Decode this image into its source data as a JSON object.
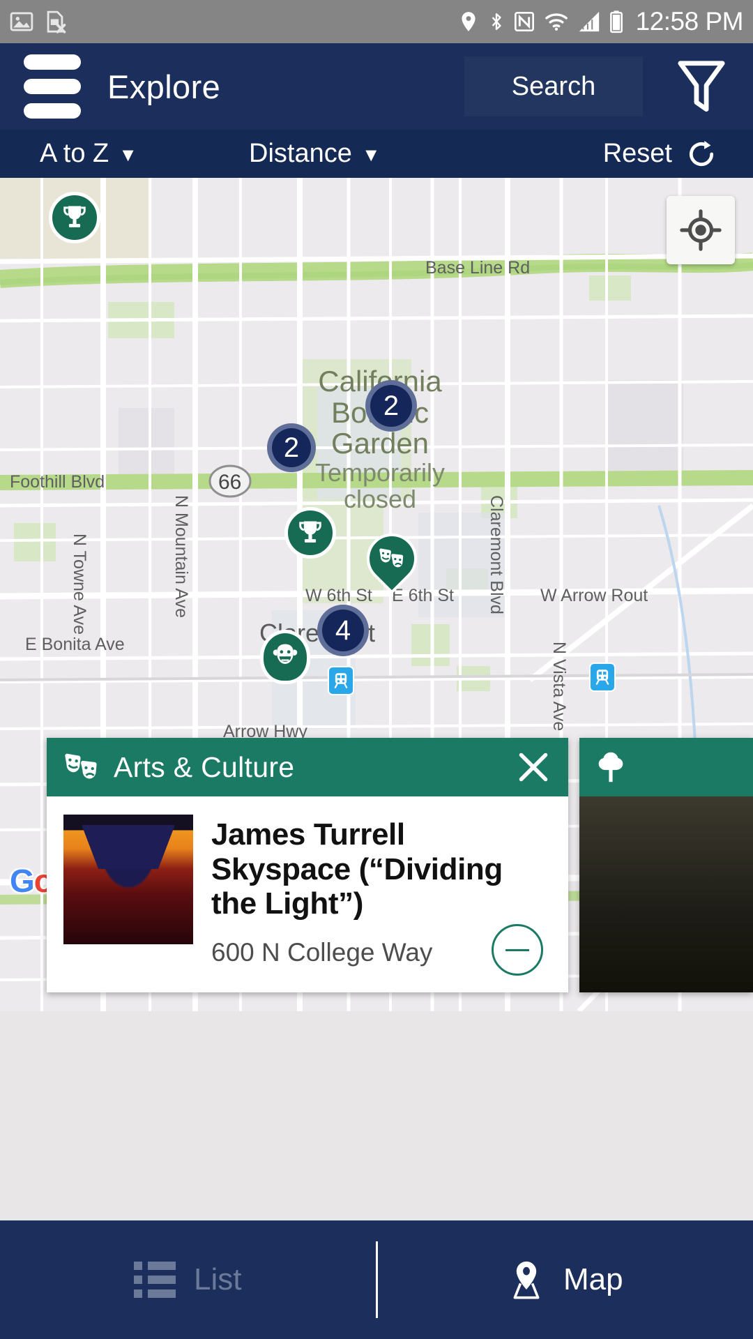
{
  "status_bar": {
    "time": "12:58 PM",
    "left_icons": [
      "photo-icon",
      "sim-card-error-icon"
    ],
    "right_icons": [
      "location-icon",
      "bluetooth-icon",
      "nfc-icon",
      "wifi-icon",
      "signal-icon",
      "battery-icon"
    ],
    "background": "#858585"
  },
  "header": {
    "menu_icon": "hamburger-icon",
    "title": "Explore",
    "search_label": "Search",
    "filter_icon": "funnel-icon",
    "background": "#1c2f5c"
  },
  "sort_bar": {
    "alpha_label": "A to Z",
    "alpha_caret": "▼",
    "distance_label": "Distance",
    "distance_caret": "▼",
    "reset_label": "Reset",
    "reset_icon": "refresh-icon",
    "background": "#142a55"
  },
  "map": {
    "provider_logo": "Google",
    "locate_icon": "my-location-icon",
    "navigate_icon": "navigation-arrow-icon",
    "place_label": {
      "name_line1": "California",
      "name_line2": "Botanic",
      "name_line3": "Garden",
      "status_line1": "Temporarily",
      "status_line2": "closed"
    },
    "street_labels": [
      "Base Line Rd",
      "Foothill Blvd",
      "N Towne Ave",
      "N Mountain Ave",
      "Claremont Blvd",
      "W 6th St",
      "E 6th St",
      "W Arrow Rout",
      "E Bonita Ave",
      "Arrow Hwy",
      "Claremont",
      "N Vista Ave"
    ],
    "route_shield": "66",
    "clusters": [
      {
        "count": "2"
      },
      {
        "count": "2"
      },
      {
        "count": "4"
      }
    ],
    "markers": [
      {
        "icon": "trophy-icon",
        "category": "sports"
      },
      {
        "icon": "trophy-icon",
        "category": "sports"
      },
      {
        "icon": "theatre-masks-icon",
        "category": "arts-culture"
      },
      {
        "icon": "comedy-mask-icon",
        "category": "entertainment"
      }
    ],
    "transit_markers": [
      "train-station-icon",
      "train-station-icon"
    ]
  },
  "card": {
    "category": "Arts & Culture",
    "category_icon": "theatre-masks-icon",
    "close_icon": "close-icon",
    "title": "James Turrell Skyspace (“Dividing the Light”)",
    "address": "600 N College Way",
    "collapse_icon": "minus-circle-icon",
    "header_color": "#1a7a64",
    "thumbnail": "skyspace-photo"
  },
  "bottom_nav": {
    "items": [
      {
        "label": "List",
        "icon": "list-icon",
        "active": false
      },
      {
        "label": "Map",
        "icon": "map-pin-icon",
        "active": true
      }
    ],
    "background": "#1c2f5c"
  }
}
